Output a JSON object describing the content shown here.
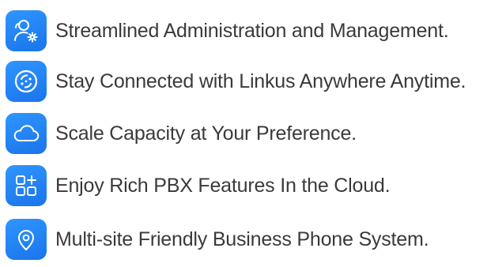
{
  "accent_color": "#1f7ff0",
  "features": [
    {
      "icon": "admin-users-gear-icon",
      "text": "Streamlined Administration and Management."
    },
    {
      "icon": "linkus-connect-icon",
      "text": "Stay Connected with Linkus Anywhere Anytime."
    },
    {
      "icon": "cloud-icon",
      "text": "Scale Capacity at Your Preference."
    },
    {
      "icon": "grid-plus-icon",
      "text": "Enjoy Rich PBX Features In the Cloud."
    },
    {
      "icon": "location-pin-icon",
      "text": "Multi-site Friendly Business Phone System."
    }
  ]
}
